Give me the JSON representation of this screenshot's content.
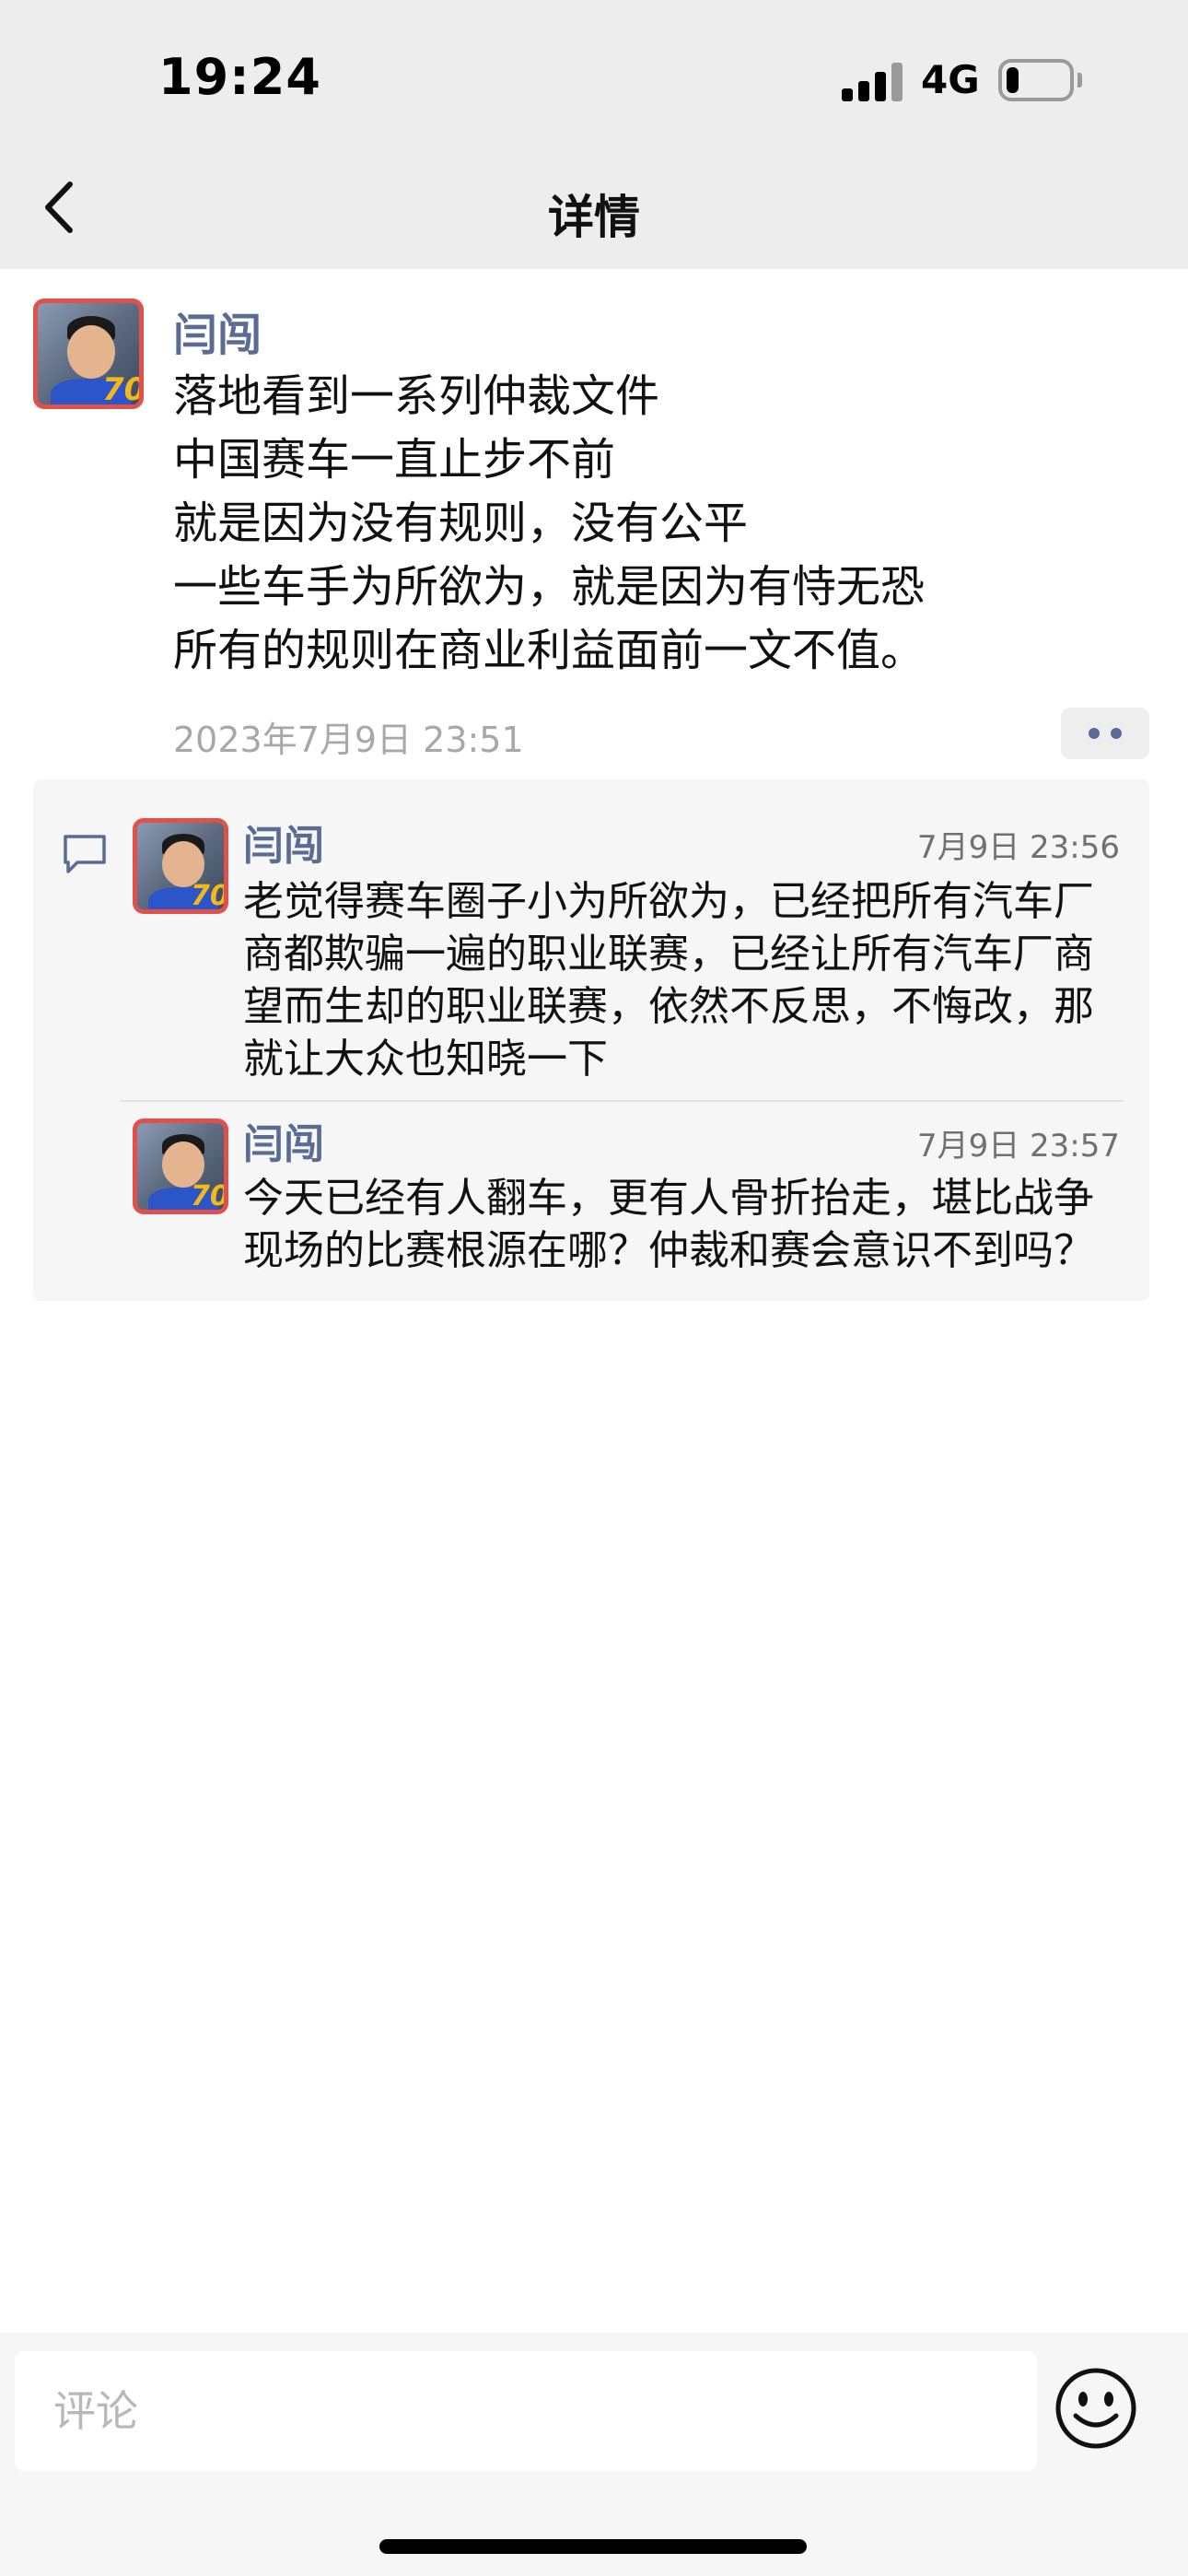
{
  "status_bar": {
    "time": "19:24",
    "network": "4G",
    "battery_level": 0.2
  },
  "nav": {
    "title": "详情"
  },
  "post": {
    "author": "闫闯",
    "lines": [
      "落地看到一系列仲裁文件",
      "中国赛车一直止步不前",
      "就是因为没有规则，没有公平",
      "一些车手为所欲为，就是因为有恃无恐",
      "所有的规则在商业利益面前一文不值。"
    ],
    "time": "2023年7月9日 23:51"
  },
  "comments": [
    {
      "author": "闫闯",
      "time": "7月9日 23:56",
      "lines": [
        "老觉得赛车圈子小为所欲为，已经把所有汽车厂",
        "商都欺骗一遍的职业联赛，已经让所有汽车厂商",
        "望而生却的职业联赛，依然不反思，不悔改，那",
        "就让大众也知晓一下"
      ]
    },
    {
      "author": "闫闯",
      "time": "7月9日 23:57",
      "lines": [
        "今天已经有人翻车，更有人骨折抬走，堪比战争",
        "现场的比赛根源在哪？仲裁和赛会意识不到吗？"
      ]
    }
  ],
  "input": {
    "placeholder": "评论"
  },
  "icons": {
    "back": "chevron-left-icon",
    "more": "more-dots-icon",
    "comment": "comment-bubble-icon",
    "emoji": "smile-emoji-icon",
    "signal": "cellular-signal-icon",
    "battery": "battery-icon"
  },
  "colors": {
    "author": "#5a6c93",
    "avatar_border": "#e1504a",
    "header_bg": "#ededed"
  }
}
